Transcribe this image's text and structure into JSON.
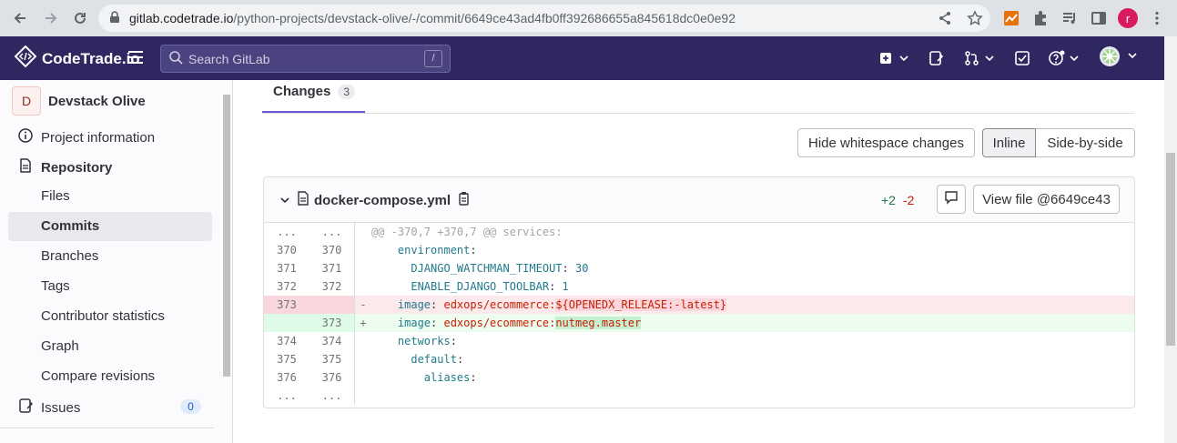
{
  "browser": {
    "url_host": "gitlab.codetrade.io",
    "url_path": "/python-projects/devstack-olive/-/commit/6649ce43ad4fb0ff392686655a845618dc0e0e92",
    "profile_initial": "r"
  },
  "topnav": {
    "logo_text": "CodeTrade.io",
    "search_placeholder": "Search GitLab",
    "search_shortcut": "/"
  },
  "sidebar": {
    "project_initial": "D",
    "project_name": "Devstack Olive",
    "items": [
      {
        "label": "Project information"
      },
      {
        "label": "Repository"
      },
      {
        "label": "Files"
      },
      {
        "label": "Commits"
      },
      {
        "label": "Branches"
      },
      {
        "label": "Tags"
      },
      {
        "label": "Contributor statistics"
      },
      {
        "label": "Graph"
      },
      {
        "label": "Compare revisions"
      },
      {
        "label": "Issues",
        "badge": "0"
      }
    ]
  },
  "tabs": {
    "changes_label": "Changes",
    "changes_count": "3"
  },
  "toolbar": {
    "hide_whitespace": "Hide whitespace changes",
    "inline": "Inline",
    "side_by_side": "Side-by-side"
  },
  "file": {
    "name": "docker-compose.yml",
    "additions": "+2",
    "deletions": "-2",
    "view_file": "View file @6649ce43"
  },
  "diff": {
    "hunk_old": "...",
    "hunk_new": "...",
    "hunk_header": "@@ -370,7 +370,7 @@ services:",
    "lines": [
      {
        "old": "370",
        "new": "370",
        "code": "    environment:"
      },
      {
        "old": "371",
        "new": "371",
        "code": "      DJANGO_WATCHMAN_TIMEOUT: 30"
      },
      {
        "old": "372",
        "new": "372",
        "code": "      ENABLE_DJANGO_TOOLBAR: 1"
      },
      {
        "old": "373",
        "new": "",
        "sign": "-",
        "code": "    image: edxops/ecommerce:${OPENEDX_RELEASE:-latest}"
      },
      {
        "old": "",
        "new": "373",
        "sign": "+",
        "code": "    image: edxops/ecommerce:nutmeg.master"
      },
      {
        "old": "374",
        "new": "374",
        "code": "    networks:"
      },
      {
        "old": "375",
        "new": "375",
        "code": "      default:"
      },
      {
        "old": "376",
        "new": "376",
        "code": "        aliases:"
      }
    ],
    "tail_old": "...",
    "tail_new": "..."
  }
}
